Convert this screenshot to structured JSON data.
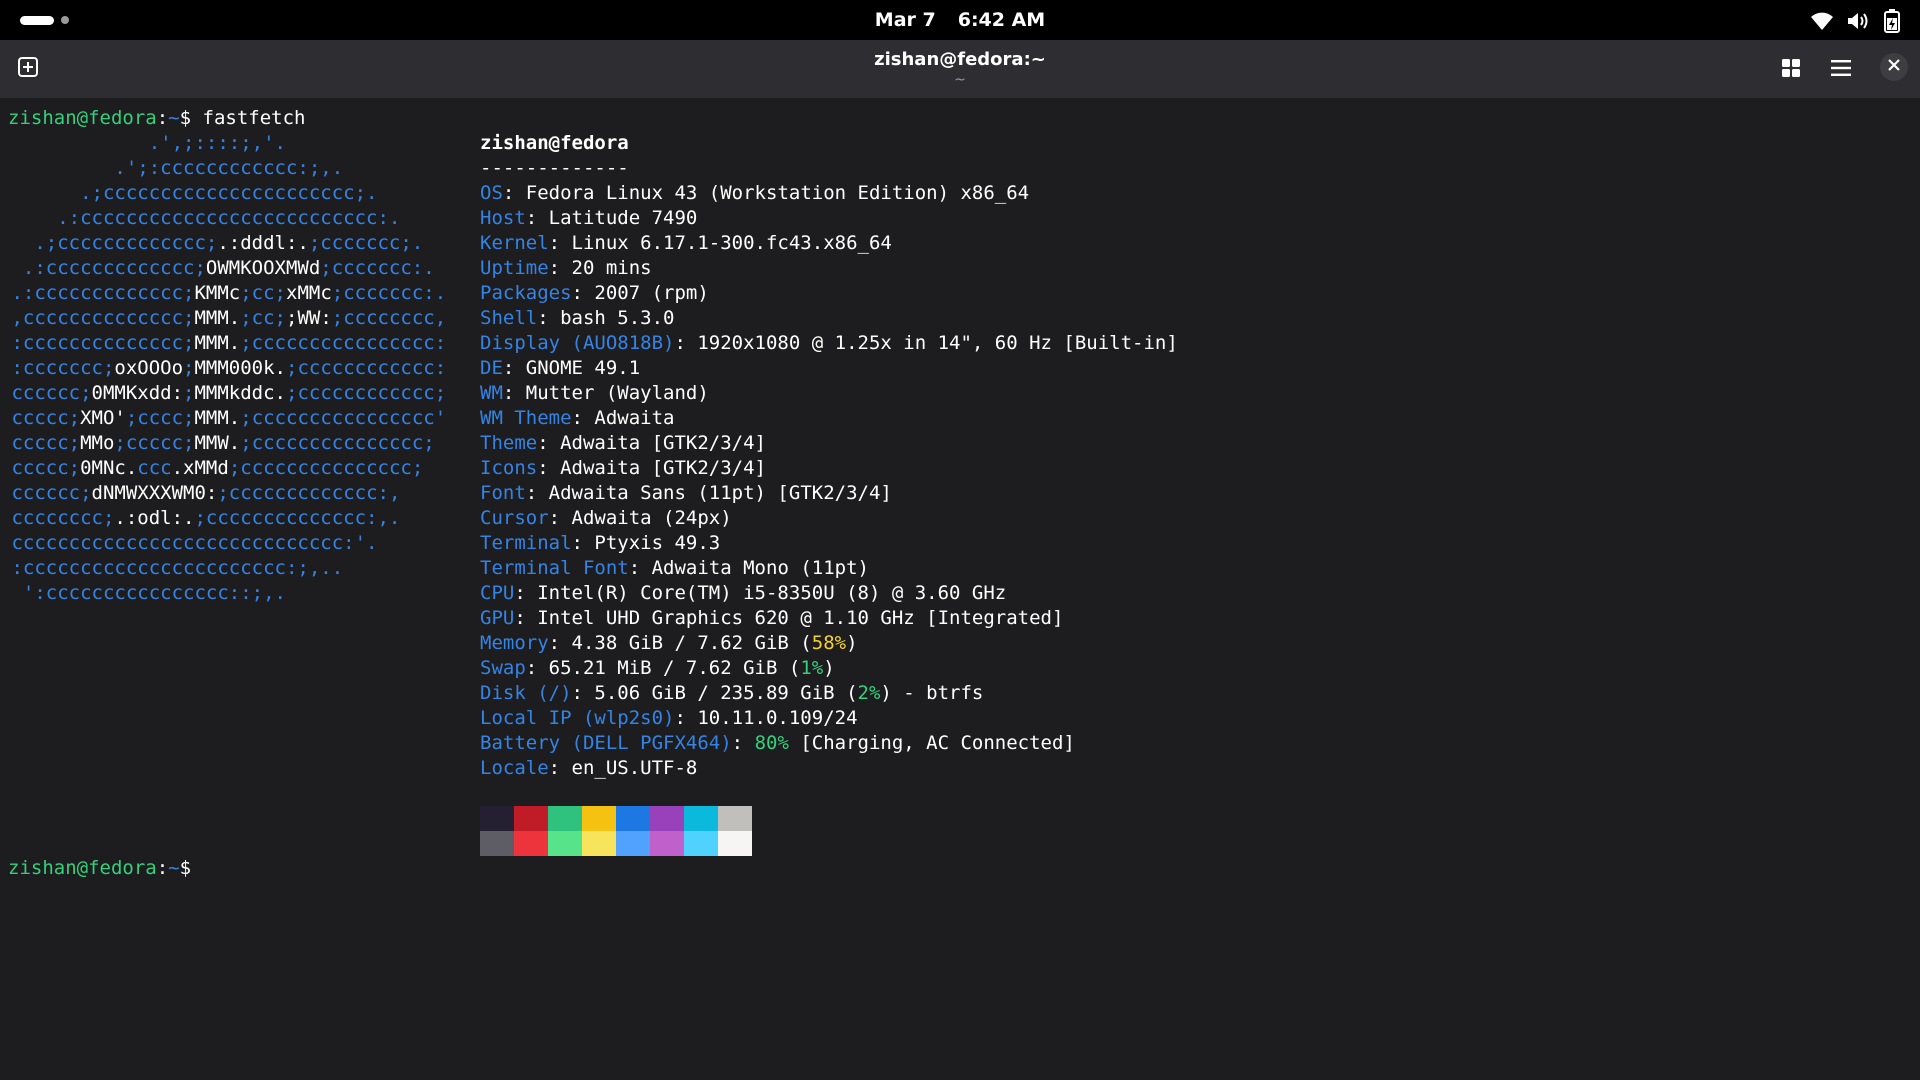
{
  "topbar": {
    "date": "Mar 7",
    "time": "6:42 AM",
    "icons": [
      "workspace-indicator",
      "wifi-icon",
      "volume-icon",
      "battery-charging-icon"
    ]
  },
  "window": {
    "title": "zishan@fedora:~",
    "subtitle": "~",
    "buttons": [
      "new-tab-icon",
      "tab-overview-icon",
      "menu-icon",
      "close-icon"
    ]
  },
  "terminal": {
    "prompt_user": "zishan@fedora",
    "prompt_sep": ":",
    "prompt_path": "~",
    "prompt_char": "$",
    "command": " fastfetch",
    "info_header": "zishan@fedora",
    "info_separator": "-------------",
    "info": [
      {
        "key": "OS",
        "value": "Fedora Linux 43 (Workstation Edition) x86_64"
      },
      {
        "key": "Host",
        "value": "Latitude 7490"
      },
      {
        "key": "Kernel",
        "value": "Linux 6.17.1-300.fc43.x86_64"
      },
      {
        "key": "Uptime",
        "value": "20 mins"
      },
      {
        "key": "Packages",
        "value": "2007 (rpm)"
      },
      {
        "key": "Shell",
        "value": "bash 5.3.0"
      },
      {
        "key": "Display (AUO818B)",
        "value": "1920x1080 @ 1.25x in 14\", 60 Hz [Built-in]"
      },
      {
        "key": "DE",
        "value": "GNOME 49.1"
      },
      {
        "key": "WM",
        "value": "Mutter (Wayland)"
      },
      {
        "key": "WM Theme",
        "value": "Adwaita"
      },
      {
        "key": "Theme",
        "value": "Adwaita [GTK2/3/4]"
      },
      {
        "key": "Icons",
        "value": "Adwaita [GTK2/3/4]"
      },
      {
        "key": "Font",
        "value": "Adwaita Sans (11pt) [GTK2/3/4]"
      },
      {
        "key": "Cursor",
        "value": "Adwaita (24px)"
      },
      {
        "key": "Terminal",
        "value": "Ptyxis 49.3"
      },
      {
        "key": "Terminal Font",
        "value": "Adwaita Mono (11pt)"
      },
      {
        "key": "CPU",
        "value": "Intel(R) Core(TM) i5-8350U (8) @ 3.60 GHz"
      },
      {
        "key": "GPU",
        "value": "Intel UHD Graphics 620 @ 1.10 GHz [Integrated]"
      },
      {
        "key": "Memory",
        "value_pre": "4.38 GiB / 7.62 GiB (",
        "value_hl": "58%",
        "value_post": ")",
        "hl_color": "yellow"
      },
      {
        "key": "Swap",
        "value_pre": "65.21 MiB / 7.62 GiB (",
        "value_hl": "1%",
        "value_post": ")",
        "hl_color": "green"
      },
      {
        "key": "Disk (/)",
        "value_pre": "5.06 GiB / 235.89 GiB (",
        "value_hl": "2%",
        "value_post": ") - btrfs",
        "hl_color": "green"
      },
      {
        "key": "Local IP (wlp2s0)",
        "value": "10.11.0.109/24"
      },
      {
        "key": "Battery (DELL PGFX464)",
        "value_pre": "",
        "value_hl": "80%",
        "value_post": " [Charging, AC Connected]",
        "hl_color": "green"
      },
      {
        "key": "Locale",
        "value": "en_US.UTF-8"
      }
    ],
    "logo_lines": [
      [
        [
          "b",
          "             .',;::::;,'."
        ]
      ],
      [
        [
          "b",
          "          .';:cccccccccccc:;,."
        ]
      ],
      [
        [
          "b",
          "       .;cccccccccccccccccccccc;."
        ]
      ],
      [
        [
          "b",
          "     .:cccccccccccccccccccccccccc:."
        ]
      ],
      [
        [
          "b",
          "   .;ccccccccccccc;"
        ],
        [
          "w",
          ".:dddl:."
        ],
        [
          "b",
          ";ccccccc;."
        ]
      ],
      [
        [
          "b",
          "  .:ccccccccccccc;"
        ],
        [
          "w",
          "OWMKOOXMWd"
        ],
        [
          "b",
          ";ccccccc:."
        ]
      ],
      [
        [
          "b",
          " .:ccccccccccccc;"
        ],
        [
          "w",
          "KMMc"
        ],
        [
          "b",
          ";cc;"
        ],
        [
          "w",
          "xMMc"
        ],
        [
          "b",
          ";ccccccc:."
        ]
      ],
      [
        [
          "b",
          " ,cccccccccccccc;"
        ],
        [
          "w",
          "MMM."
        ],
        [
          "b",
          ";cc;"
        ],
        [
          "w",
          ";WW:"
        ],
        [
          "b",
          ";cccccccc,"
        ]
      ],
      [
        [
          "b",
          " :cccccccccccccc;"
        ],
        [
          "w",
          "MMM."
        ],
        [
          "b",
          ";cccccccccccccccc:"
        ]
      ],
      [
        [
          "b",
          " :ccccccc;"
        ],
        [
          "w",
          "oxOOOo"
        ],
        [
          "b",
          ";"
        ],
        [
          "w",
          "MMM000k."
        ],
        [
          "b",
          ";cccccccccccc:"
        ]
      ],
      [
        [
          "b",
          " cccccc;"
        ],
        [
          "w",
          "0MMKxdd:"
        ],
        [
          "b",
          ";"
        ],
        [
          "w",
          "MMMkddc."
        ],
        [
          "b",
          ";cccccccccccc;"
        ]
      ],
      [
        [
          "b",
          " ccccc;"
        ],
        [
          "w",
          "XMO'"
        ],
        [
          "b",
          ";cccc;"
        ],
        [
          "w",
          "MMM."
        ],
        [
          "b",
          ";cccccccccccccccc'"
        ]
      ],
      [
        [
          "b",
          " ccccc;"
        ],
        [
          "w",
          "MMo"
        ],
        [
          "b",
          ";ccccc;"
        ],
        [
          "w",
          "MMW."
        ],
        [
          "b",
          ";ccccccccccccccc;"
        ]
      ],
      [
        [
          "b",
          " ccccc;"
        ],
        [
          "w",
          "0MNc."
        ],
        [
          "b",
          "ccc"
        ],
        [
          "w",
          ".xMMd"
        ],
        [
          "b",
          ";ccccccccccccccc;"
        ]
      ],
      [
        [
          "b",
          " cccccc;"
        ],
        [
          "w",
          "dNMWXXXWM0:"
        ],
        [
          "b",
          ";ccccccccccccc:,"
        ]
      ],
      [
        [
          "b",
          " cccccccc;"
        ],
        [
          "w",
          ".:odl:."
        ],
        [
          "b",
          ";cccccccccccccc:,."
        ]
      ],
      [
        [
          "b",
          " ccccccccccccccccccccccccccccc:'."
        ]
      ],
      [
        [
          "b",
          " :ccccccccccccccccccccccc:;,.."
        ]
      ],
      [
        [
          "b",
          "  ':cccccccccccccccc::;,."
        ]
      ]
    ],
    "palette_top": [
      "#241f31",
      "#c01c28",
      "#2ec27e",
      "#f5c211",
      "#1e78e4",
      "#9841bb",
      "#0ab9dc",
      "#c0bfbc"
    ],
    "palette_bottom": [
      "#5e5c64",
      "#ed333b",
      "#57e389",
      "#f8e45c",
      "#51a1ff",
      "#c061cb",
      "#4fd2fd",
      "#f6f5f4"
    ]
  }
}
